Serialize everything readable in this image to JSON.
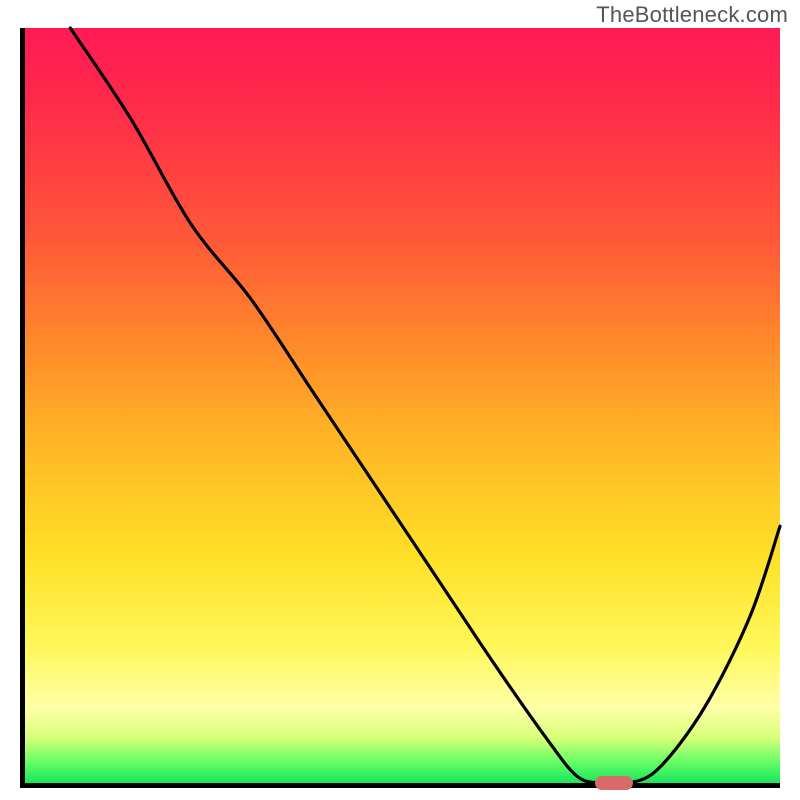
{
  "watermark": "TheBottleneck.com",
  "chart_data": {
    "type": "line",
    "title": "",
    "xlabel": "",
    "ylabel": "",
    "xlim": [
      0,
      100
    ],
    "ylim": [
      0,
      100
    ],
    "grid": false,
    "legend": false,
    "series": [
      {
        "name": "bottleneck-curve",
        "x": [
          6,
          14,
          22,
          30,
          38,
          46,
          54,
          62,
          69,
          73,
          76,
          80,
          84,
          90,
          96,
          100
        ],
        "y": [
          100,
          88,
          74,
          64,
          52,
          40,
          28,
          16,
          6,
          1,
          0,
          0,
          2,
          10,
          22,
          34
        ]
      }
    ],
    "annotations": [
      {
        "name": "optimal-marker",
        "x_center": 77.5,
        "width_pct": 5,
        "y": 0,
        "color": "#d86a6a"
      }
    ],
    "background_gradient": {
      "direction": "vertical",
      "stops": [
        {
          "pos": 0.0,
          "color": "#ff1a55"
        },
        {
          "pos": 0.28,
          "color": "#ff5838"
        },
        {
          "pos": 0.55,
          "color": "#ffb726"
        },
        {
          "pos": 0.82,
          "color": "#fff85a"
        },
        {
          "pos": 0.94,
          "color": "#d8ff7a"
        },
        {
          "pos": 1.0,
          "color": "#18e65e"
        }
      ]
    }
  }
}
